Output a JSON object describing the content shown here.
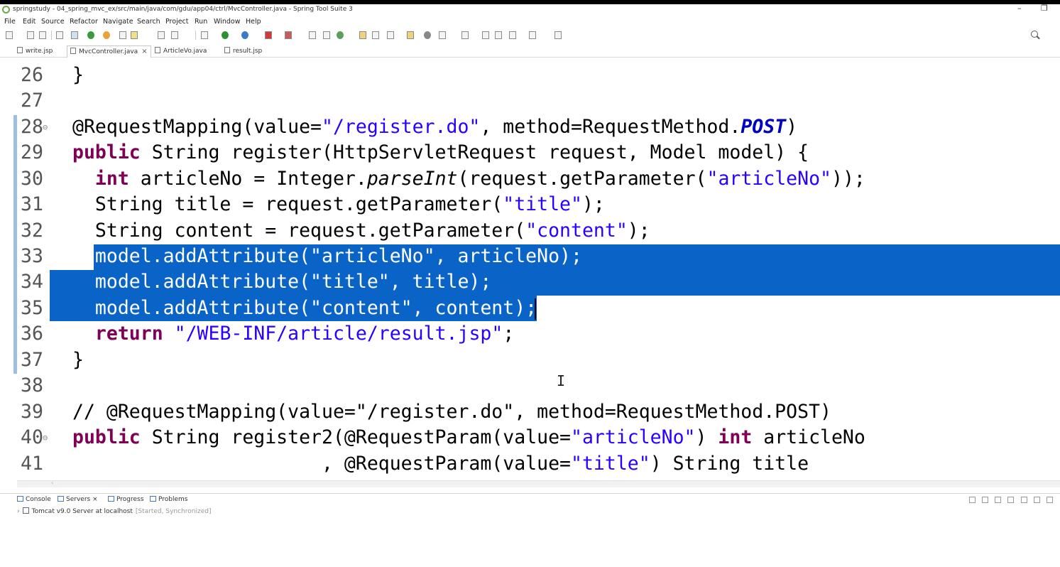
{
  "window": {
    "title": "springstudy - 04_spring_mvc_ex/src/main/java/com/gdu/app04/ctrl/MvcController.java - Spring Tool Suite 3"
  },
  "menu": [
    "File",
    "Edit",
    "Source",
    "Refactor",
    "Navigate",
    "Search",
    "Project",
    "Run",
    "Window",
    "Help"
  ],
  "tabs": [
    {
      "label": "write.jsp",
      "active": false
    },
    {
      "label": "MvcController.java",
      "active": true
    },
    {
      "label": "ArticleVo.java",
      "active": false
    },
    {
      "label": "result.jsp",
      "active": false
    }
  ],
  "editor": {
    "lines": [
      {
        "num": "26",
        "fold": "",
        "text": "}"
      },
      {
        "num": "27",
        "fold": "",
        "text": ""
      },
      {
        "num": "28",
        "fold": "⊖",
        "text": "@RequestMapping(value=\"/register.do\", method=RequestMethod.POST)"
      },
      {
        "num": "29",
        "fold": "",
        "text": "public String register(HttpServletRequest request, Model model) {"
      },
      {
        "num": "30",
        "fold": "",
        "text": "  int articleNo = Integer.parseInt(request.getParameter(\"articleNo\"));"
      },
      {
        "num": "31",
        "fold": "",
        "text": "  String title = request.getParameter(\"title\");"
      },
      {
        "num": "32",
        "fold": "",
        "text": "  String content = request.getParameter(\"content\");"
      },
      {
        "num": "33",
        "fold": "",
        "text": "  model.addAttribute(\"articleNo\", articleNo);"
      },
      {
        "num": "34",
        "fold": "",
        "text": "  model.addAttribute(\"title\", title);"
      },
      {
        "num": "35",
        "fold": "",
        "text": "  model.addAttribute(\"content\", content);"
      },
      {
        "num": "36",
        "fold": "",
        "text": "  return \"/WEB-INF/article/result.jsp\";"
      },
      {
        "num": "37",
        "fold": "",
        "text": "}"
      },
      {
        "num": "38",
        "fold": "",
        "text": ""
      },
      {
        "num": "39",
        "fold": "",
        "text": "// @RequestMapping(value=\"/register.do\", method=RequestMethod.POST)"
      },
      {
        "num": "40",
        "fold": "⊖",
        "text": "public String register2(@RequestParam(value=\"articleNo\") int articleNo"
      },
      {
        "num": "41",
        "fold": "",
        "text": "                      , @RequestParam(value=\"title\") String title"
      }
    ]
  },
  "bottom_panel": {
    "tabs": [
      "Console",
      "Servers",
      "Progress",
      "Problems"
    ],
    "server": {
      "name": "Tomcat v9.0 Server at localhost",
      "status": "[Started, Synchronized]"
    }
  },
  "colors": {
    "selection": "#0a64c8",
    "keyword": "#7f0055",
    "string": "#2a00ff",
    "comment": "#3f7f5f"
  },
  "icons": [
    "app-icon",
    "search-icon",
    "close-icon",
    "java-file-icon",
    "jsp-file-icon",
    "server-icon",
    "console-icon"
  ]
}
